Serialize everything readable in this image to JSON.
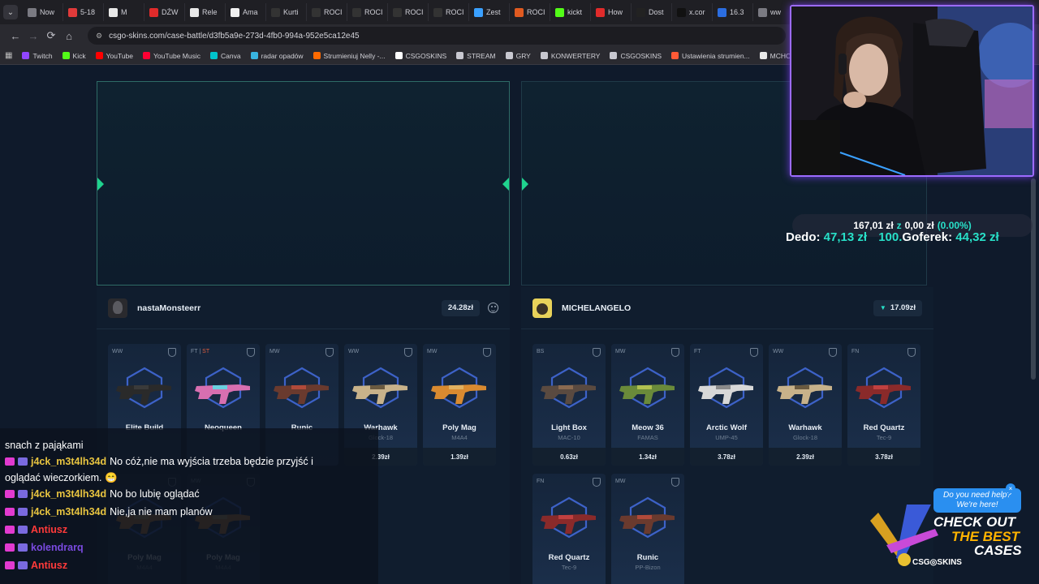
{
  "browser": {
    "tabs": [
      {
        "label": "Now",
        "color": "#7a7a82"
      },
      {
        "label": "5-18",
        "color": "#e03a3a"
      },
      {
        "label": "M",
        "color": "#e8e8e8"
      },
      {
        "label": "DŹW",
        "color": "#e02b2b"
      },
      {
        "label": "Rele",
        "color": "#e8e8e8"
      },
      {
        "label": "Ama",
        "color": "#f0f0f0"
      },
      {
        "label": "Kurti",
        "color": "#333"
      },
      {
        "label": "ROCI",
        "color": "#333"
      },
      {
        "label": "ROCI",
        "color": "#333"
      },
      {
        "label": "ROCI",
        "color": "#333"
      },
      {
        "label": "ROCI",
        "color": "#333"
      },
      {
        "label": "Zest",
        "color": "#3aa0ff"
      },
      {
        "label": "ROCI",
        "color": "#e05a20"
      },
      {
        "label": "kickt",
        "color": "#53fc18"
      },
      {
        "label": "How",
        "color": "#e02b2b"
      },
      {
        "label": "Dost",
        "color": "#222"
      },
      {
        "label": "x.cor",
        "color": "#111"
      },
      {
        "label": "16.3",
        "color": "#2b6de0"
      },
      {
        "label": "ww",
        "color": "#7a7a82"
      }
    ],
    "url": "csgo-skins.com/case-battle/d3fb5a9e-273d-4fb0-994a-952e5ca12e45",
    "bookmarks": [
      {
        "label": "Twitch",
        "color": "#9146ff"
      },
      {
        "label": "Kick",
        "color": "#53fc18"
      },
      {
        "label": "YouTube",
        "color": "#ff0000"
      },
      {
        "label": "YouTube Music",
        "color": "#ff0033"
      },
      {
        "label": "Canva",
        "color": "#00c4cc"
      },
      {
        "label": "radar opadów",
        "color": "#39b5e0"
      },
      {
        "label": "Strumieniuj Nelly -...",
        "color": "#ff6a00"
      },
      {
        "label": "CSGOSKINS",
        "color": "#ffffff"
      },
      {
        "label": "STREAM",
        "color": "#c8c8d0"
      },
      {
        "label": "GRY",
        "color": "#c8c8d0"
      },
      {
        "label": "KONWERTERY",
        "color": "#c8c8d0"
      },
      {
        "label": "CSGOSKINS",
        "color": "#c8c8d0"
      },
      {
        "label": "Ustawienia strumien...",
        "color": "#ff5a36"
      },
      {
        "label": "MCHOSE HUB",
        "color": "#e8e8e8"
      }
    ]
  },
  "players": [
    {
      "name": "nastaMonsteerr",
      "total": "24.28zł",
      "items": [
        {
          "wear": "WW",
          "wear2": "",
          "name": "Elite Build",
          "sub": "",
          "price": "",
          "faded": false,
          "gun": "#2a2a2a",
          "accent": "#3a3a3a"
        },
        {
          "wear": "FT",
          "wear2": "ST",
          "name": "Neoqueen",
          "sub": "",
          "price": "",
          "faded": false,
          "gun": "#d86fb0",
          "accent": "#6ad0e0"
        },
        {
          "wear": "MW",
          "wear2": "",
          "name": "Runic",
          "sub": "",
          "price": "",
          "faded": false,
          "gun": "#6a3a2e",
          "accent": "#b04a3a"
        },
        {
          "wear": "WW",
          "wear2": "",
          "name": "Warhawk",
          "sub": "Glock-18",
          "price": "2.39zł",
          "faded": false,
          "gun": "#c8b28a",
          "accent": "#6a5a40"
        },
        {
          "wear": "MW",
          "wear2": "",
          "name": "Poly Mag",
          "sub": "M4A4",
          "price": "1.39zł",
          "faded": false,
          "gun": "#d98a30",
          "accent": "#e0b060"
        },
        {
          "wear": "",
          "wear2": "",
          "name": "Poly Mag",
          "sub": "M4A4",
          "price": "",
          "faded": true,
          "gun": "#d98a30",
          "accent": "#e0b060"
        },
        {
          "wear": "MW",
          "wear2": "",
          "name": "Poly Mag",
          "sub": "M4A4",
          "price": "",
          "faded": true,
          "gun": "#d98a30",
          "accent": "#e0b060"
        }
      ]
    },
    {
      "name": "MICHELANGELO",
      "total": "17.09zł",
      "items": [
        {
          "wear": "BS",
          "wear2": "",
          "name": "Light Box",
          "sub": "MAC-10",
          "price": "0.63zł",
          "faded": false,
          "gun": "#5a4a40",
          "accent": "#8a6a50"
        },
        {
          "wear": "MW",
          "wear2": "",
          "name": "Meow 36",
          "sub": "FAMAS",
          "price": "1.34zł",
          "faded": false,
          "gun": "#6a8a3a",
          "accent": "#b0c050"
        },
        {
          "wear": "FT",
          "wear2": "",
          "name": "Arctic Wolf",
          "sub": "UMP-45",
          "price": "3.78zł",
          "faded": false,
          "gun": "#d8d8d8",
          "accent": "#8a8a8a"
        },
        {
          "wear": "WW",
          "wear2": "",
          "name": "Warhawk",
          "sub": "Glock-18",
          "price": "2.39zł",
          "faded": false,
          "gun": "#c8b28a",
          "accent": "#6a5a40"
        },
        {
          "wear": "FN",
          "wear2": "",
          "name": "Red Quartz",
          "sub": "Tec-9",
          "price": "3.78zł",
          "faded": false,
          "gun": "#8a2a2a",
          "accent": "#c04040"
        },
        {
          "wear": "FN",
          "wear2": "",
          "name": "Red Quartz",
          "sub": "Tec-9",
          "price": "",
          "faded": false,
          "gun": "#8a2a2a",
          "accent": "#c04040"
        },
        {
          "wear": "MW",
          "wear2": "",
          "name": "Runic",
          "sub": "PP-Bizon",
          "price": "",
          "faded": false,
          "gun": "#6a3a2e",
          "accent": "#b04a3a"
        }
      ]
    }
  ],
  "overlay": {
    "stats_line1_a": "167,01 zł",
    "stats_line1_z": "z",
    "stats_line1_b": "0,00 zł",
    "stats_line1_pct": "(0.00%)",
    "stats_line2_n1": "Dedo:",
    "stats_line2_v1": "47,13 zł",
    "stats_line2_v2": "100.",
    "stats_line2_n2": "Goferek:",
    "stats_line2_v3": "44,32 zł"
  },
  "chat": [
    {
      "user": "",
      "ucolor": "#ffffff",
      "text": "snach z pająkami"
    },
    {
      "user": "j4ck_m3t4lh34d",
      "ucolor": "#e8c440",
      "text": "No cóż,nie ma wyjścia trzeba będzie przyjść i"
    },
    {
      "user": "",
      "ucolor": "#ffffff",
      "text": "oglądać wieczorkiem. 😁"
    },
    {
      "user": "j4ck_m3t4lh34d",
      "ucolor": "#e8c440",
      "text": "No bo lubię oglądać"
    },
    {
      "user": "j4ck_m3t4lh34d",
      "ucolor": "#e8c440",
      "text": "Nie,ja nie mam planów"
    },
    {
      "user": "Antiusz",
      "ucolor": "#ff3a3a",
      "text": ""
    },
    {
      "user": "kolendrarq",
      "ucolor": "#7a4ae0",
      "text": ""
    },
    {
      "user": "Antiusz",
      "ucolor": "#ff3a3a",
      "text": ""
    }
  ],
  "ad": {
    "help": "Do you need help? We're here!",
    "close": "×",
    "line1": "CHECK OUT",
    "line2": "THE BEST",
    "line3": "CASES",
    "logo": "CSG◎SKINS"
  }
}
